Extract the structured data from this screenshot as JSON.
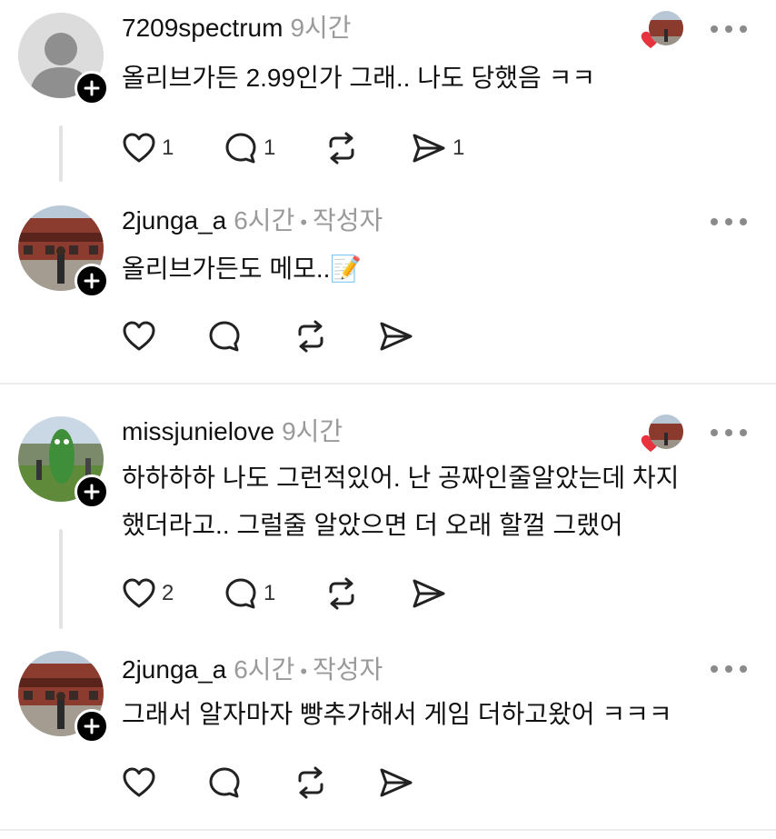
{
  "posts": [
    {
      "username": "7209spectrum",
      "time": "9시간",
      "author_tag": "",
      "lines": [
        "올리브가든 2.99인가 그래.. 나도 당했음 ㅋㅋ"
      ],
      "likes": "1",
      "replies": "1",
      "reposts": "",
      "shares": "1"
    },
    {
      "username": "2junga_a",
      "time": "6시간",
      "author_tag": "작성자",
      "lines": [
        "올리브가든도 메모..📝"
      ],
      "likes": "",
      "replies": "",
      "reposts": "",
      "shares": ""
    },
    {
      "username": "missjunielove",
      "time": "9시간",
      "author_tag": "",
      "lines": [
        "하하하하 나도 그런적있어. 난 공짜인줄알았는데 차지",
        "했더라고.. 그럴줄 알았으면 더 오래 할껄 그랬어"
      ],
      "likes": "2",
      "replies": "1",
      "reposts": "",
      "shares": ""
    },
    {
      "username": "2junga_a",
      "time": "6시간",
      "author_tag": "작성자",
      "lines": [
        "그래서 알자마자 빵추가해서 게임 더하고왔어 ㅋㅋㅋ"
      ],
      "likes": "",
      "replies": "",
      "reposts": "",
      "shares": ""
    }
  ],
  "colors": {
    "text": "#111111",
    "muted": "#9a9a9a",
    "heart_red": "#e8333f",
    "divider": "#ececec"
  },
  "icons": [
    "heart-icon",
    "comment-icon",
    "repost-icon",
    "send-icon",
    "more-icon",
    "plus-icon",
    "liked-by-author-heart-icon"
  ]
}
